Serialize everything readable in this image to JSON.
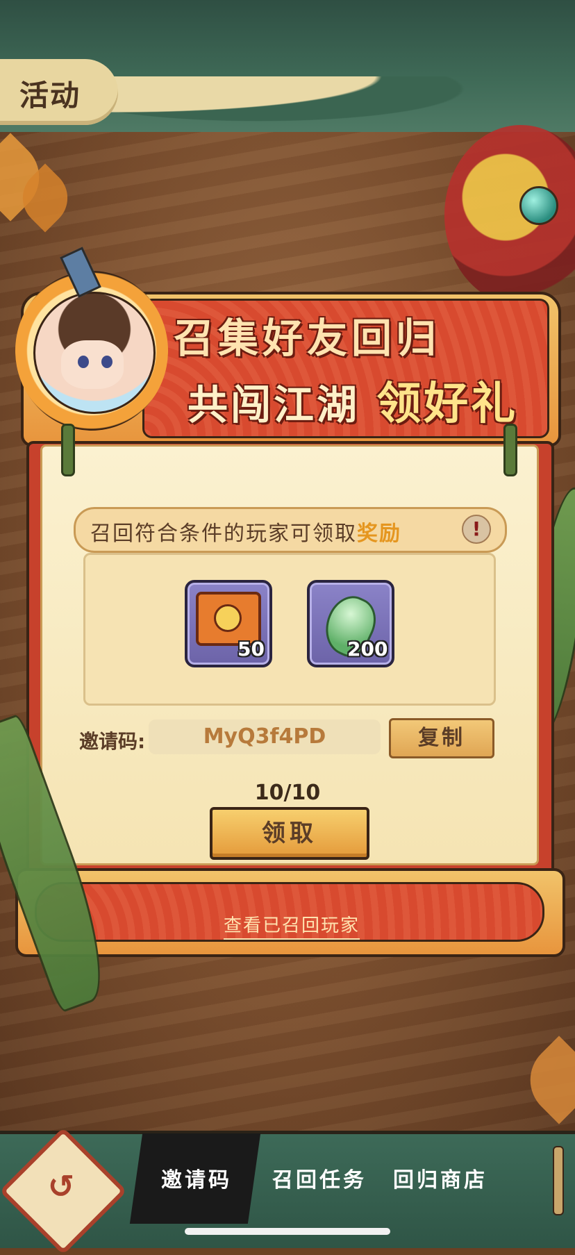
{
  "header": {
    "title": "活动"
  },
  "banner": {
    "line1": "召集好友回归",
    "line2_prefix": "共闯江湖 ",
    "line2_accent": "领好礼"
  },
  "notice": {
    "text_prefix": "召回符合条件的玩家可领取",
    "text_highlight": "奖励",
    "info_icon": "!"
  },
  "rewards": [
    {
      "icon": "treasure-chest-icon",
      "quantity": "50"
    },
    {
      "icon": "jade-pendant-icon",
      "quantity": "200"
    }
  ],
  "invite": {
    "label": "邀请码:",
    "code": "MyQ3f4PD",
    "copy_label": "复制"
  },
  "progress": {
    "text": "10/10"
  },
  "claim": {
    "label": "领取"
  },
  "view_link": {
    "label": "查看已召回玩家"
  },
  "bottom_nav": {
    "back_icon": "↺",
    "tabs": [
      {
        "label": "邀请码",
        "active": true
      },
      {
        "label": "召回任务",
        "active": false
      },
      {
        "label": "回归商店",
        "active": false
      }
    ]
  },
  "colors": {
    "accent_orange": "#e89a3c",
    "banner_red": "#d84a2f",
    "nav_green": "#3d6a58",
    "highlight_gold": "#e5961f"
  }
}
